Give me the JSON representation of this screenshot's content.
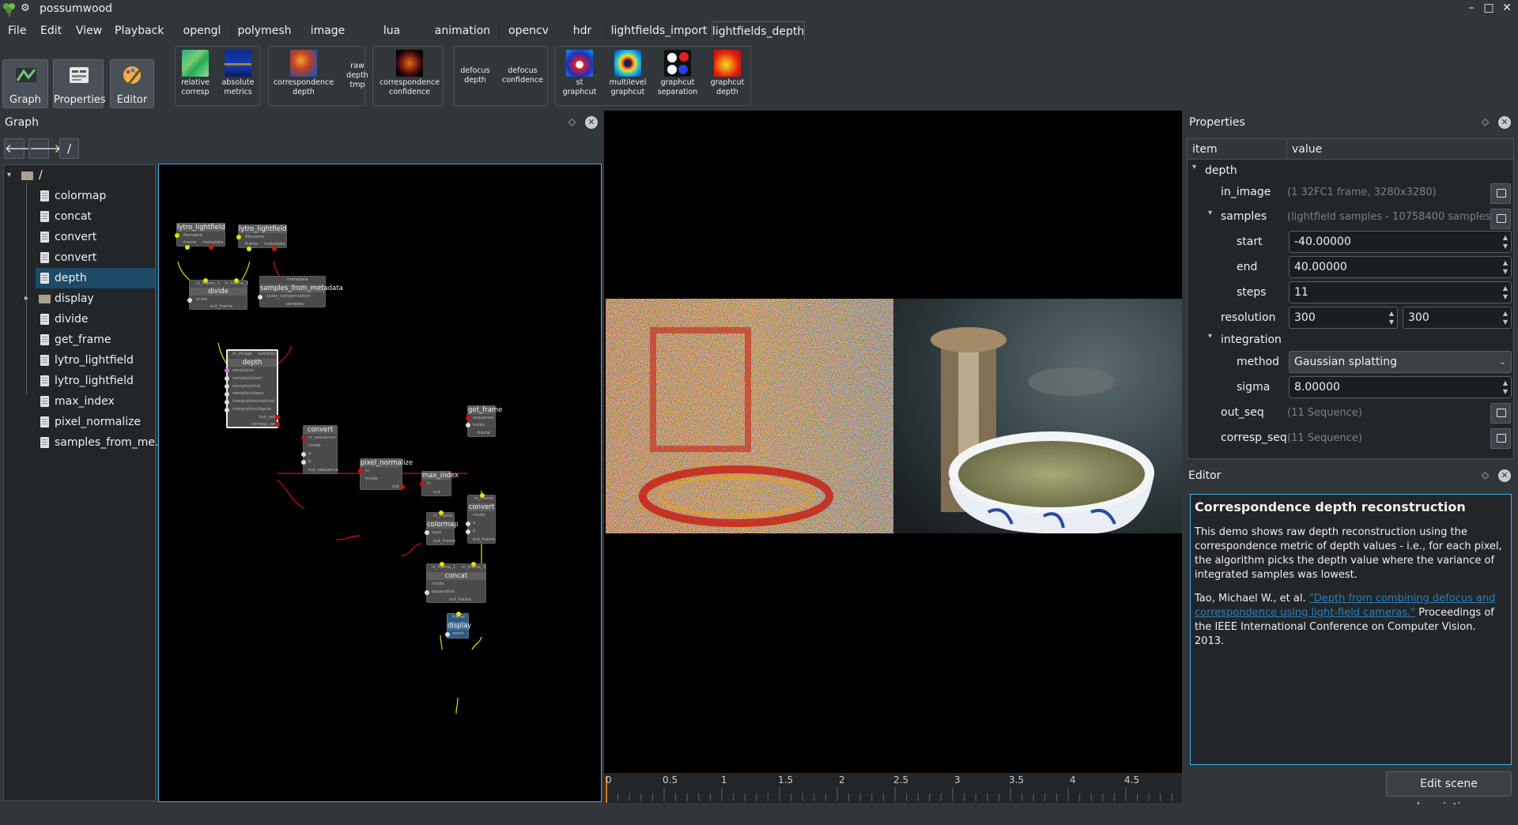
{
  "window": {
    "title": "possumwood",
    "minimize": "–",
    "maximize": "□",
    "close": "✕"
  },
  "menu": [
    "File",
    "Edit",
    "View",
    "Playback"
  ],
  "tabs": [
    {
      "label": "opengl",
      "active": false
    },
    {
      "label": "polymesh",
      "active": false
    },
    {
      "label": "image",
      "active": false
    },
    {
      "label": "lua",
      "active": false
    },
    {
      "label": "animation",
      "active": false
    },
    {
      "label": "opencv",
      "active": false
    },
    {
      "label": "hdr",
      "active": false
    },
    {
      "label": "lightfields_import",
      "active": false
    },
    {
      "label": "lightfields_depth",
      "active": true
    }
  ],
  "modes": [
    {
      "label": "Graph",
      "icon": "graph-icon"
    },
    {
      "label": "Properties",
      "icon": "properties-icon"
    },
    {
      "label": "Editor",
      "icon": "editor-icon"
    }
  ],
  "tools": [
    {
      "label": "relative\ncorresp"
    },
    {
      "label": "absolute\nmetrics"
    },
    {
      "label": "correspondence\ndepth"
    },
    {
      "label": "raw\ndepth\ntmp"
    },
    {
      "label": "correspondence\nconfidence"
    },
    {
      "label": "defocus\ndepth"
    },
    {
      "label": "defocus\nconfidence"
    },
    {
      "label": "st\ngraphcut"
    },
    {
      "label": "multilevel\ngraphcut"
    },
    {
      "label": "graphcut\nseparation"
    },
    {
      "label": "graphcut\ndepth"
    }
  ],
  "graph_panel": {
    "title": "Graph",
    "path": "/",
    "back": "🡐",
    "forward": "🡒",
    "tree_root": "/",
    "tree": [
      "colormap",
      "concat",
      "convert",
      "convert",
      "depth",
      "display",
      "divide",
      "get_frame",
      "lytro_lightfield",
      "lytro_lightfield",
      "max_index",
      "pixel_normalize",
      "samples_from_me..."
    ]
  },
  "nodes": {
    "lytro1": {
      "title": "lytro_lightfield",
      "p1": "filename",
      "p2": "frame",
      "p3": "metadata"
    },
    "lytro2": {
      "title": "lytro_lightfield",
      "p1": "filename",
      "p2": "frame",
      "p3": "metadata"
    },
    "divide": {
      "title": "divide",
      "in1": "in_frame_1",
      "in2": "in_frame_2",
      "p1": "scale",
      "out": "out_frame"
    },
    "sfm": {
      "title": "samples_from_metadata",
      "in": "metadata",
      "p1": "scale_compensation",
      "out": "samples"
    },
    "depth": {
      "title": "depth",
      "in1": "in_image",
      "in2": "samples",
      "p1": "resolution",
      "p2": "samples/start",
      "p3": "samples/end",
      "p4": "samples/steps",
      "p5": "integration/method",
      "p6": "integration/sigma",
      "o1": "out_seq",
      "o2": "corresp_seq"
    },
    "getframe": {
      "title": "get_frame",
      "p1": "sequence",
      "p2": "index",
      "out": "frame"
    },
    "convert1": {
      "title": "convert",
      "p1": "in_sequence",
      "p2": "mode",
      "p3": "a",
      "p4": "b",
      "out": "out_sequence"
    },
    "pixnorm": {
      "title": "pixel_normalize",
      "p1": "in",
      "p2": "mode",
      "out": "out"
    },
    "maxidx": {
      "title": "max_index",
      "p1": "in",
      "out": "out"
    },
    "colormap": {
      "title": "colormap",
      "in": "in_frame",
      "p1": "type",
      "out": "out_frame"
    },
    "convert2": {
      "title": "convert",
      "in": "in_frame",
      "p1": "mode",
      "p2": "a",
      "p3": "b",
      "out": "out_frame"
    },
    "concat": {
      "title": "concat",
      "in1": "in_frame_1",
      "in2": "in_frame_2",
      "p1": "mode",
      "p2": "separation",
      "out": "out_frame"
    },
    "display": {
      "title": "display",
      "in": "frame",
      "p1": "zoom"
    }
  },
  "timeline": {
    "ticks": [
      "0",
      "0.5",
      "1",
      "1.5",
      "2",
      "2.5",
      "3",
      "3.5",
      "4",
      "4.5"
    ]
  },
  "properties_panel": {
    "title": "Properties",
    "col_item": "item",
    "col_value": "value",
    "node": "depth",
    "in_image_label": "in_image",
    "in_image_value": "(1 32FC1 frame, 3280x3280)",
    "samples_label": "samples",
    "samples_value": "(lightfield samples - 10758400 samples)",
    "start_label": "start",
    "start_value": "-40.00000",
    "end_label": "end",
    "end_value": "40.00000",
    "steps_label": "steps",
    "steps_value": "11",
    "resolution_label": "resolution",
    "resolution_x": "300",
    "resolution_y": "300",
    "integration_label": "integration",
    "method_label": "method",
    "method_value": "Gaussian splatting",
    "sigma_label": "sigma",
    "sigma_value": "8.00000",
    "out_seq_label": "out_seq",
    "out_seq_value": "(11 Sequence)",
    "corresp_seq_label": "corresp_seq",
    "corresp_seq_value": "(11 Sequence)"
  },
  "editor_panel": {
    "title": "Editor",
    "heading": "Correspondence depth reconstruction",
    "para1": "This demo shows raw depth reconstruction using the correspondence metric of depth values - i.e., for each pixel, the algorithm picks the depth value where the variance of integrated samples was lowest.",
    "para2_pre": "Tao, Michael W., et al. ",
    "para2_link": "\"Depth from combining defocus and correspondence using light-field cameras.\"",
    "para2_post": " Proceedings of the IEEE International Conference on Computer Vision. 2013.",
    "edit_button": "Edit scene description..."
  },
  "colors": {
    "accent": "#3daee9",
    "wire_yellow": "#e8e000",
    "wire_red": "#d01010",
    "selection": "#1d4a66"
  }
}
